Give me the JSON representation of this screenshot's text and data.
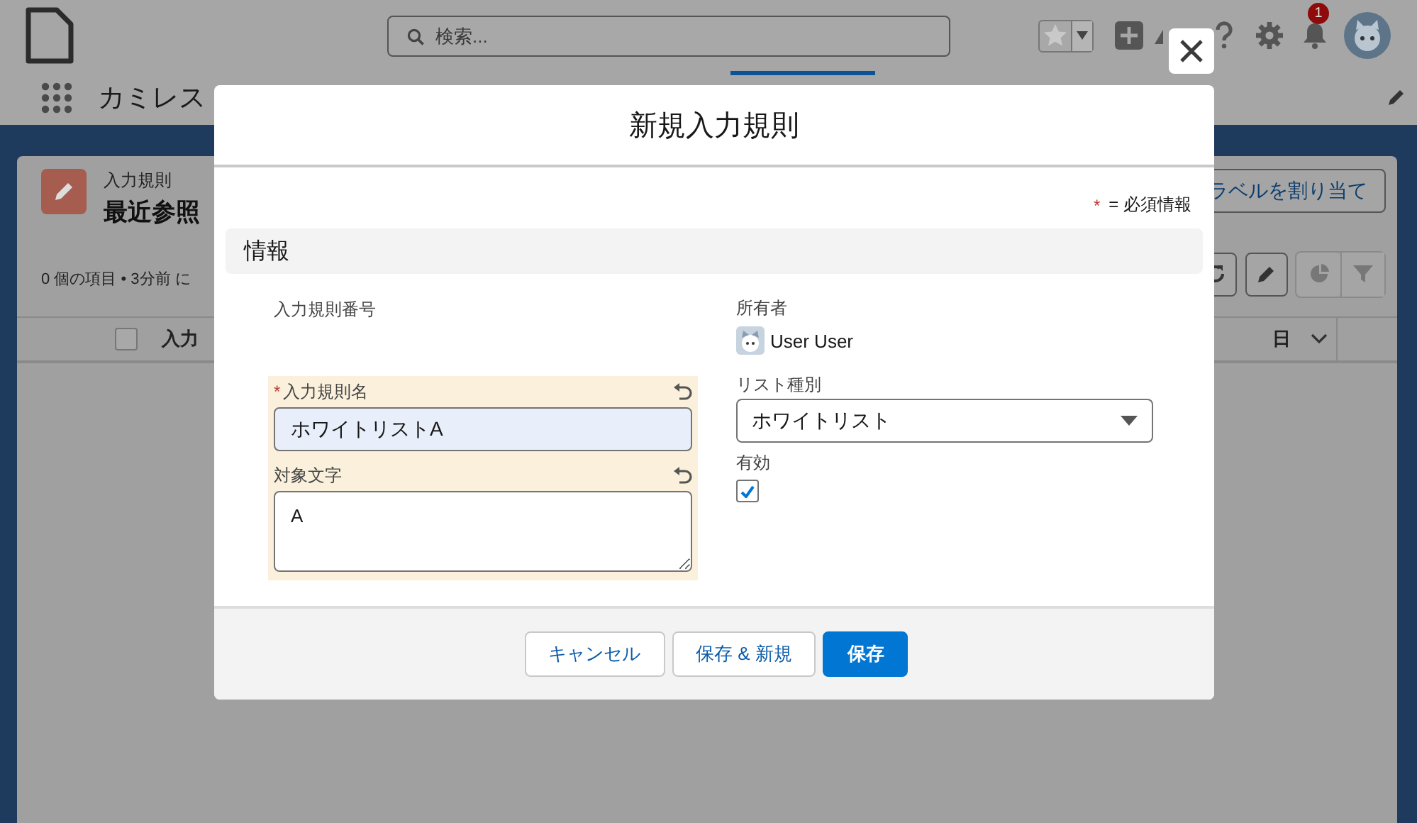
{
  "header": {
    "search": {
      "placeholder": "検索..."
    },
    "notification_count": "1"
  },
  "nav": {
    "app_name": "カミレス"
  },
  "list_view": {
    "object_label": "入力規則",
    "select_all_checked": false,
    "title": "最近参照",
    "status": "0 個の項目 • 3分前 に",
    "assign_label_button": "ラベルを割り当て",
    "columns": [
      {
        "label": "入力",
        "kind": "checkbox-first"
      },
      {
        "label": "日",
        "kind": "sortable"
      }
    ]
  },
  "modal": {
    "title": "新規入力規則",
    "required_mark": "*",
    "required_legend": "= 必須情報",
    "section": "情報",
    "left_fields": [
      {
        "kind": "readonly",
        "label": "入力規則番号",
        "required": false,
        "edited": false
      },
      {
        "kind": "text",
        "label": "入力規則名",
        "value": "ホワイトリストA",
        "required": true,
        "edited": true
      },
      {
        "kind": "textarea",
        "label": "対象文字",
        "value": "A",
        "required": false,
        "edited": true
      }
    ],
    "right_fields": [
      {
        "kind": "owner",
        "label": "所有者",
        "value": "User User"
      },
      {
        "kind": "picklist",
        "label": "リスト種別",
        "value": "ホワイトリスト"
      },
      {
        "kind": "checkbox",
        "label": "有効",
        "checked": true
      }
    ],
    "buttons": [
      {
        "label": "キャンセル",
        "kind": "neutral"
      },
      {
        "label": "保存 & 新規",
        "kind": "neutral"
      },
      {
        "label": "保存",
        "kind": "brand"
      }
    ]
  }
}
